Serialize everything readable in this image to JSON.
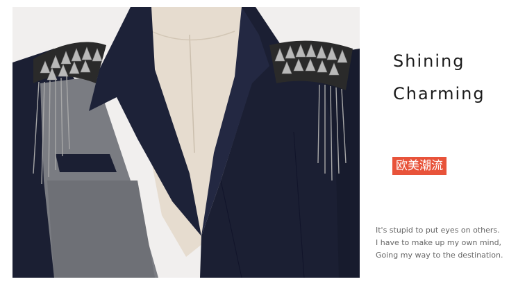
{
  "headline": {
    "line1": "Shining",
    "line2": "Charming"
  },
  "badge": {
    "text": "欧美潮流"
  },
  "caption": {
    "lines": [
      "It's stupid to put eyes on others.",
      "I have to make up my own mind,",
      "Going my way to the destination."
    ]
  },
  "colors": {
    "badge_background": "#e8533a",
    "jacket_navy": "#1b1f33",
    "jacket_gray": "#7a7c82",
    "mannequin": "#e6dccf"
  }
}
